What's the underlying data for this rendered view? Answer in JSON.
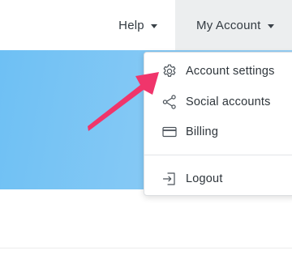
{
  "nav": {
    "help_label": "Help",
    "account_label": "My Account"
  },
  "menu": {
    "items": [
      {
        "label": "Account settings",
        "icon": "gear-icon"
      },
      {
        "label": "Social accounts",
        "icon": "share-icon"
      },
      {
        "label": "Billing",
        "icon": "credit-card-icon"
      },
      {
        "label": "Logout",
        "icon": "logout-icon"
      }
    ]
  },
  "colors": {
    "hero": "#7dc6f4",
    "nav_active_bg": "#eceeef",
    "annotation_arrow": "#f0356b",
    "text": "#2e353b"
  }
}
